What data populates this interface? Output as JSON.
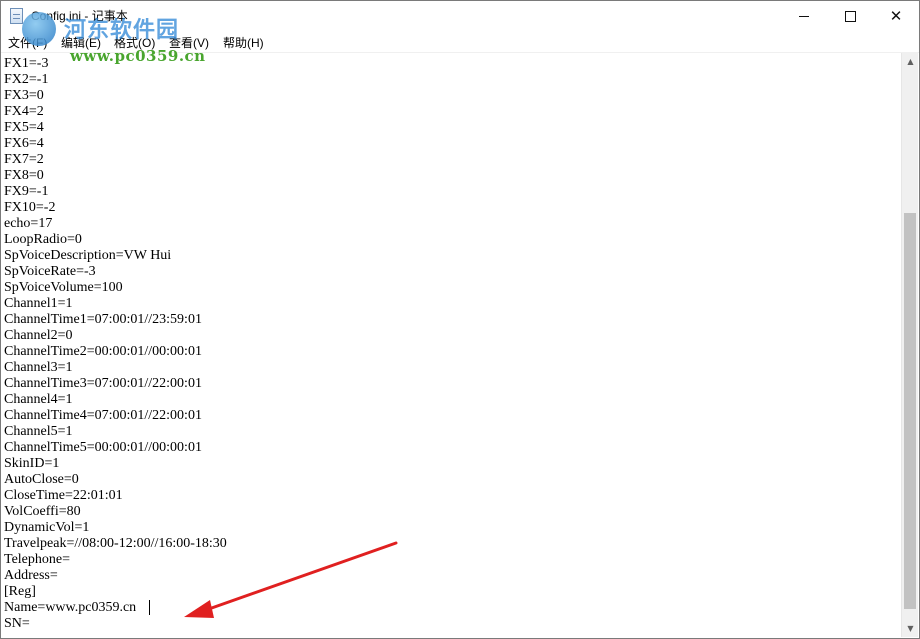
{
  "window": {
    "title": "Config.ini - 记事本"
  },
  "menu": [
    {
      "label": "文件(F)"
    },
    {
      "label": "编辑(E)"
    },
    {
      "label": "格式(O)"
    },
    {
      "label": "查看(V)"
    },
    {
      "label": "帮助(H)"
    }
  ],
  "watermark": {
    "title": "河东软件园",
    "url": "www.pc0359.cn"
  },
  "editor": {
    "lines": [
      "FX1=-3",
      "FX2=-1",
      "FX3=0",
      "FX4=2",
      "FX5=4",
      "FX6=4",
      "FX7=2",
      "FX8=0",
      "FX9=-1",
      "FX10=-2",
      "echo=17",
      "LoopRadio=0",
      "SpVoiceDescription=VW Hui",
      "SpVoiceRate=-3",
      "SpVoiceVolume=100",
      "Channel1=1",
      "ChannelTime1=07:00:01//23:59:01",
      "Channel2=0",
      "ChannelTime2=00:00:01//00:00:01",
      "Channel3=1",
      "ChannelTime3=07:00:01//22:00:01",
      "Channel4=1",
      "ChannelTime4=07:00:01//22:00:01",
      "Channel5=1",
      "ChannelTime5=00:00:01//00:00:01",
      "SkinID=1",
      "AutoClose=0",
      "CloseTime=22:01:01",
      "VolCoeffi=80",
      "DynamicVol=1",
      "Travelpeak=//08:00-12:00//16:00-18:30",
      "Telephone=",
      "Address=",
      "[Reg]",
      "Name=www.pc0359.cn",
      "SN="
    ]
  },
  "colors": {
    "annotation_arrow": "#e02020"
  },
  "icons": {
    "app": "notepad-icon",
    "minimize": "minimize-icon",
    "maximize": "maximize-icon",
    "close": "close-icon"
  }
}
